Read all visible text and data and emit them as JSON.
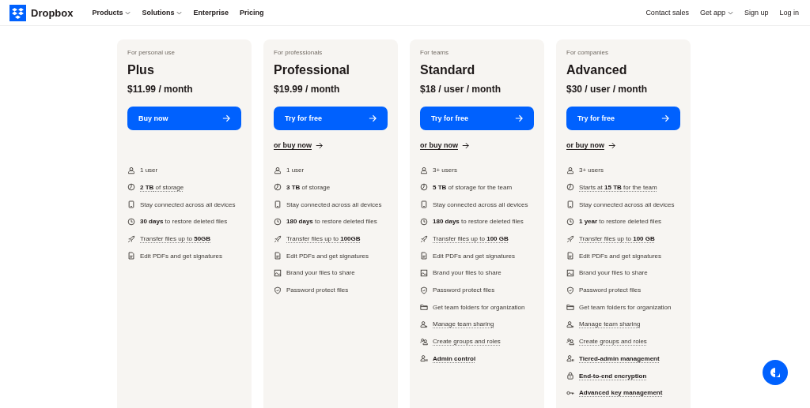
{
  "nav": {
    "brand": "Dropbox",
    "links": [
      {
        "label": "Products",
        "dropdown": true
      },
      {
        "label": "Solutions",
        "dropdown": true
      },
      {
        "label": "Enterprise",
        "dropdown": false
      },
      {
        "label": "Pricing",
        "dropdown": false
      }
    ],
    "actions": [
      {
        "label": "Contact sales",
        "dropdown": false
      },
      {
        "label": "Get app",
        "dropdown": true
      },
      {
        "label": "Sign up",
        "dropdown": false
      },
      {
        "label": "Log in",
        "dropdown": false
      }
    ]
  },
  "plans": [
    {
      "audience": "For personal use",
      "name": "Plus",
      "price": "$11.99 / month",
      "cta": "Buy now",
      "features": [
        {
          "kind": "user",
          "text": "1 user",
          "dotted": false,
          "strong": false
        },
        {
          "kind": "storage",
          "text": "**2 TB** of storage",
          "dotted": true,
          "strong": false
        },
        {
          "kind": "device",
          "text": "Stay connected across all devices",
          "dotted": false,
          "strong": false
        },
        {
          "kind": "clock",
          "text": "**30 days** to restore deleted files",
          "dotted": false,
          "strong": false
        },
        {
          "kind": "rocket",
          "text": "Transfer files up to **50GB**",
          "dotted": true,
          "strong": false
        },
        {
          "kind": "pdf",
          "text": "Edit PDFs and get signatures",
          "dotted": false,
          "strong": false
        }
      ]
    },
    {
      "audience": "For professionals",
      "name": "Professional",
      "price": "$19.99 / month",
      "cta": "Try for free",
      "alt_link": "or buy now",
      "features": [
        {
          "kind": "user",
          "text": "1 user",
          "dotted": false,
          "strong": false
        },
        {
          "kind": "storage",
          "text": "**3 TB** of storage",
          "dotted": false,
          "strong": false
        },
        {
          "kind": "device",
          "text": "Stay connected across all devices",
          "dotted": false,
          "strong": false
        },
        {
          "kind": "clock",
          "text": "**180 days** to restore deleted files",
          "dotted": false,
          "strong": false
        },
        {
          "kind": "rocket",
          "text": "Transfer files up to **100GB**",
          "dotted": true,
          "strong": false
        },
        {
          "kind": "pdf",
          "text": "Edit PDFs and get signatures",
          "dotted": false,
          "strong": false
        },
        {
          "kind": "image",
          "text": "Brand your files to share",
          "dotted": false,
          "strong": false
        },
        {
          "kind": "shield",
          "text": "Password protect files",
          "dotted": false,
          "strong": false
        }
      ]
    },
    {
      "audience": "For teams",
      "name": "Standard",
      "price": "$18 / user / month",
      "cta": "Try for free",
      "alt_link": "or buy now",
      "features": [
        {
          "kind": "user",
          "text": "3+ users",
          "dotted": false,
          "strong": false
        },
        {
          "kind": "storage",
          "text": "**5 TB** of storage for the team",
          "dotted": false,
          "strong": false
        },
        {
          "kind": "device",
          "text": "Stay connected across all devices",
          "dotted": false,
          "strong": false
        },
        {
          "kind": "clock",
          "text": "**180 days**  to restore deleted files",
          "dotted": false,
          "strong": false
        },
        {
          "kind": "rocket",
          "text": "Transfer files up to **100 GB**",
          "dotted": true,
          "strong": false
        },
        {
          "kind": "pdf",
          "text": "Edit PDFs and get signatures",
          "dotted": false,
          "strong": false
        },
        {
          "kind": "image",
          "text": "Brand your files to share",
          "dotted": false,
          "strong": false
        },
        {
          "kind": "shield",
          "text": "Password protect files",
          "dotted": false,
          "strong": false
        },
        {
          "kind": "folder",
          "text": "Get team folders for organization",
          "dotted": false,
          "strong": false
        },
        {
          "kind": "user-share",
          "text": "Manage team sharing",
          "dotted": true,
          "strong": false
        },
        {
          "kind": "group",
          "text": "Create groups and roles",
          "dotted": true,
          "strong": false
        },
        {
          "kind": "admin",
          "text": "Admin control",
          "dotted": true,
          "strong": true
        }
      ]
    },
    {
      "audience": "For companies",
      "name": "Advanced",
      "price": "$30 / user / month",
      "cta": "Try for free",
      "alt_link": "or buy now",
      "features": [
        {
          "kind": "user",
          "text": "3+ users",
          "dotted": false,
          "strong": false
        },
        {
          "kind": "storage",
          "text": "Starts at **15 TB** for the team",
          "dotted": true,
          "strong": false
        },
        {
          "kind": "device",
          "text": "Stay connected across all devices",
          "dotted": false,
          "strong": false
        },
        {
          "kind": "clock",
          "text": "**1 year** to restore deleted files",
          "dotted": false,
          "strong": false
        },
        {
          "kind": "rocket",
          "text": "Transfer files up to **100 GB**",
          "dotted": true,
          "strong": false
        },
        {
          "kind": "pdf",
          "text": "Edit PDFs and get signatures",
          "dotted": false,
          "strong": false
        },
        {
          "kind": "image",
          "text": "Brand your files to share",
          "dotted": false,
          "strong": false
        },
        {
          "kind": "shield",
          "text": "Password protect files",
          "dotted": false,
          "strong": false
        },
        {
          "kind": "folder",
          "text": "Get team folders for organization",
          "dotted": false,
          "strong": false
        },
        {
          "kind": "user-share",
          "text": "Manage team sharing",
          "dotted": true,
          "strong": false
        },
        {
          "kind": "group",
          "text": "Create groups and roles",
          "dotted": true,
          "strong": false
        },
        {
          "kind": "admin",
          "text": "Tiered-admin management",
          "dotted": true,
          "strong": true
        },
        {
          "kind": "lock",
          "text": "End-to-end encryption",
          "dotted": true,
          "strong": true
        },
        {
          "kind": "key",
          "text": "Advanced key management",
          "dotted": true,
          "strong": true
        }
      ]
    }
  ]
}
